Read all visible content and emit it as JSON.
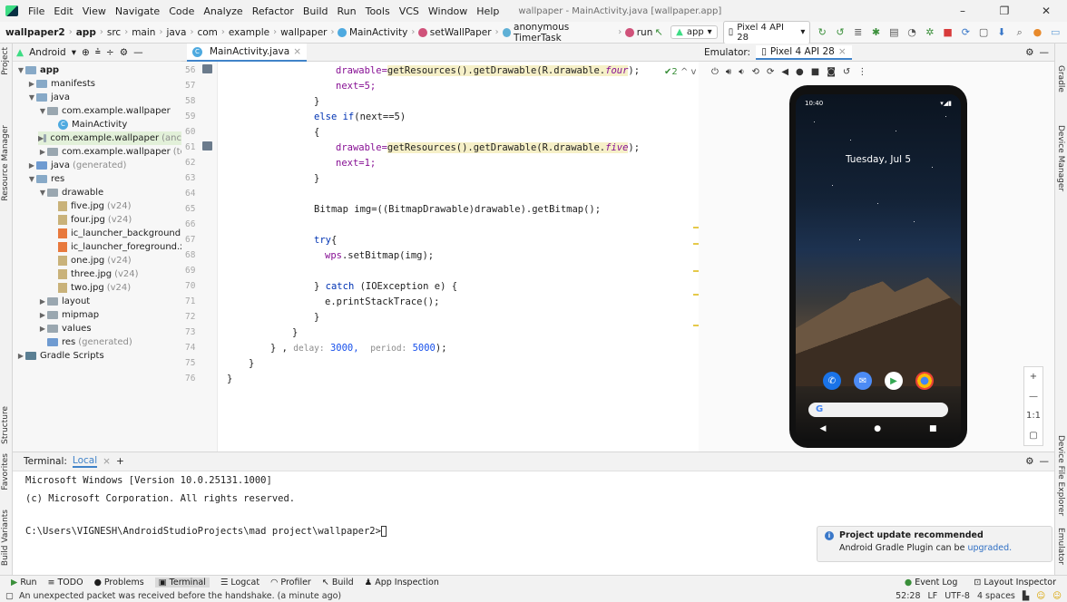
{
  "menu": {
    "items": [
      "File",
      "Edit",
      "View",
      "Navigate",
      "Code",
      "Analyze",
      "Refactor",
      "Build",
      "Run",
      "Tools",
      "VCS",
      "Window",
      "Help"
    ],
    "window_title": "wallpaper - MainActivity.java [wallpaper.app]",
    "win_min": "–",
    "win_max": "❐",
    "win_close": "✕"
  },
  "breadcrumb": {
    "items": [
      "wallpaper2",
      "app",
      "src",
      "main",
      "java",
      "com",
      "example",
      "wallpaper",
      "MainActivity",
      "setWallPaper",
      "anonymous TimerTask",
      "run"
    ],
    "sep": "›"
  },
  "toolbar_top": {
    "config": "app",
    "device": "Pixel 4 API 28"
  },
  "left_strip": {
    "tabs": [
      "Project",
      "Resource Manager",
      "Structure",
      "Favorites",
      "Build Variants"
    ]
  },
  "right_strip": {
    "tabs": [
      "Gradle",
      "Device Manager",
      "Device File Explorer",
      "Emulator"
    ]
  },
  "project": {
    "view": "Android",
    "tree": [
      {
        "label": "app",
        "extra": ""
      },
      {
        "label": "manifests",
        "extra": ""
      },
      {
        "label": "java",
        "extra": ""
      },
      {
        "label": "com.example.wallpaper",
        "extra": ""
      },
      {
        "label": "MainActivity",
        "extra": ""
      },
      {
        "label": "com.example.wallpaper",
        "extra": "(anc"
      },
      {
        "label": "com.example.wallpaper",
        "extra": "(test"
      },
      {
        "label": "java",
        "extra": "(generated)"
      },
      {
        "label": "res",
        "extra": ""
      },
      {
        "label": "drawable",
        "extra": ""
      },
      {
        "label": "five.jpg",
        "extra": "(v24)"
      },
      {
        "label": "four.jpg",
        "extra": "(v24)"
      },
      {
        "label": "ic_launcher_background.x",
        "extra": ""
      },
      {
        "label": "ic_launcher_foreground.xi",
        "extra": ""
      },
      {
        "label": "one.jpg",
        "extra": "(v24)"
      },
      {
        "label": "three.jpg",
        "extra": "(v24)"
      },
      {
        "label": "two.jpg",
        "extra": "(v24)"
      },
      {
        "label": "layout",
        "extra": ""
      },
      {
        "label": "mipmap",
        "extra": ""
      },
      {
        "label": "values",
        "extra": ""
      },
      {
        "label": "res",
        "extra": "(generated)"
      },
      {
        "label": "Gradle Scripts",
        "extra": ""
      }
    ]
  },
  "editor": {
    "tab": "MainActivity.java",
    "line_numbers": [
      "56",
      "57",
      "58",
      "59",
      "60",
      "61",
      "62",
      "63",
      "64",
      "65",
      "66",
      "67",
      "68",
      "69",
      "70",
      "71",
      "72",
      "73",
      "74",
      "75",
      "76"
    ],
    "problems_count": "2",
    "code": {
      "l56a": "drawable=",
      "l56b": "getResources().getDrawable(R.drawable.",
      "l56c": "four",
      "l56d": ");",
      "l57": "next=5;",
      "l58": "}",
      "l59a": "else if",
      "l59b": "(next==5)",
      "l60": "{",
      "l61a": "drawable=",
      "l61b": "getResources().getDrawable(R.drawable.",
      "l61c": "five",
      "l61d": ");",
      "l62": "next=1;",
      "l63": "}",
      "l65": "Bitmap img=((BitmapDrawable)drawable).getBitmap();",
      "l67a": "try",
      "l67b": "{",
      "l68a": "wps",
      "l68b": ".setBitmap(img);",
      "l70a": "} ",
      "l70b": "catch",
      "l70c": " (IOException e) {",
      "l71": "e.printStackTrace();",
      "l72": "}",
      "l73": "}",
      "l74a": "} ,",
      "l74_delay_hint": "delay:",
      "l74_delay": "3000,",
      "l74_period_hint": "period:",
      "l74_period": "5000",
      "l74e": ");",
      "l75": "}",
      "l76": "}"
    }
  },
  "emulator": {
    "label": "Emulator:",
    "tab": "Pixel 4 API 28",
    "time": "10:40",
    "date": "Tuesday, Jul 5",
    "zoom_label": "1:1"
  },
  "terminal": {
    "label": "Terminal:",
    "tab": "Local",
    "lines": [
      "Microsoft Windows [Version 10.0.25131.1000]",
      "(c) Microsoft Corporation. All rights reserved.",
      "C:\\Users\\VIGNESH\\AndroidStudioProjects\\mad project\\wallpaper2>"
    ]
  },
  "notification": {
    "title": "Project update recommended",
    "body": "Android Gradle Plugin can be",
    "link": "upgraded."
  },
  "bottom_tools": {
    "run": "Run",
    "todo": "TODO",
    "problems": "Problems",
    "terminal": "Terminal",
    "logcat": "Logcat",
    "profiler": "Profiler",
    "build": "Build",
    "app_inspection": "App Inspection",
    "event_log": "Event Log",
    "layout_inspector": "Layout Inspector"
  },
  "status": {
    "message": "An unexpected packet was received before the handshake. (a minute ago)",
    "position": "52:28",
    "line_sep": "LF",
    "encoding": "UTF-8",
    "indent": "4 spaces"
  },
  "colors": {
    "accent": "#4083c9",
    "keyword": "#0033b3",
    "field": "#871094",
    "number": "#1750eb"
  }
}
